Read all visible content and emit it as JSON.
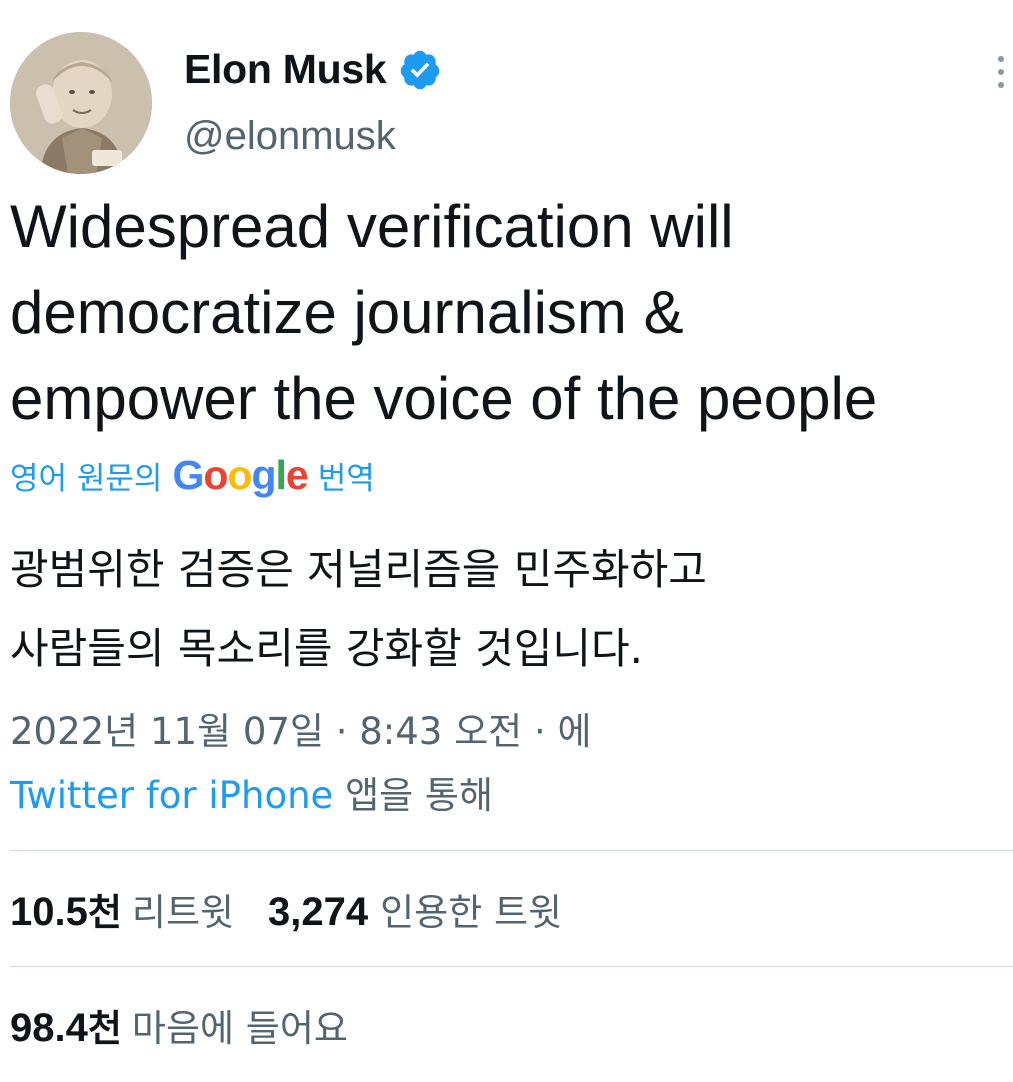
{
  "author": {
    "name": "Elon Musk",
    "handle": "@elonmusk",
    "verified_badge": "verified-badge",
    "badge_color": "#1d9bf0"
  },
  "tweet": {
    "text_lines": [
      "Widespread verification will",
      "democratize journalism &",
      "empower the voice of the people"
    ]
  },
  "translation": {
    "prefix": "영어 원문의",
    "provider": "Google",
    "suffix": "번역",
    "lines": [
      "광범위한 검증은 저널리즘을 민주화하고",
      "사람들의 목소리를 강화할 것입니다."
    ]
  },
  "meta": {
    "timestamp": "2022년 11월 07일 · 8:43 오전 · 에",
    "source": "Twitter for iPhone",
    "source_suffix": "앱을 통해"
  },
  "stats": {
    "retweets_value": "10.5",
    "retweets_unit": "천",
    "retweets_label": "리트윗",
    "quotes_value": "3,274",
    "quotes_label": "인용한 트윗",
    "likes_value": "98.4",
    "likes_unit": "천",
    "likes_label": "마음에 들어요"
  },
  "colors": {
    "link": "#1d9bf0",
    "secondary_text": "#536471",
    "primary_text": "#0f1419"
  }
}
